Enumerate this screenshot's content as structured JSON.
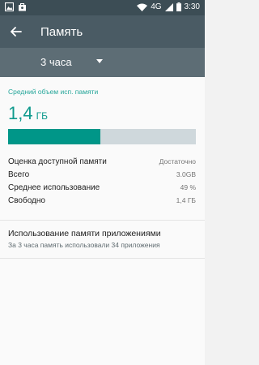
{
  "status_bar": {
    "network": "4G",
    "time": "3:30",
    "icons": [
      "gallery-icon",
      "bag-icon",
      "wifi-icon",
      "signal-icon",
      "battery-icon"
    ]
  },
  "app_bar": {
    "title": "Память",
    "back_icon": "arrow-back-icon"
  },
  "filter": {
    "period": "3 часа",
    "dropdown_icon": "caret-down-icon"
  },
  "memory": {
    "section_title": "Средний объем исп. памяти",
    "value": "1,4",
    "unit": "ГБ",
    "usage_fraction": 0.49,
    "accent_color": "#009688",
    "track_color": "#cfd8dc",
    "rows": [
      {
        "label": "Оценка доступной памяти",
        "value": "Достаточно"
      },
      {
        "label": "Всего",
        "value": "3.0GB"
      },
      {
        "label": "Среднее использование",
        "value": "49 %"
      },
      {
        "label": "Свободно",
        "value": "1,4 ГБ"
      }
    ]
  },
  "apps_memory": {
    "title": "Использование памяти приложениями",
    "summary": "За 3 часа память использовали 34 приложения"
  }
}
